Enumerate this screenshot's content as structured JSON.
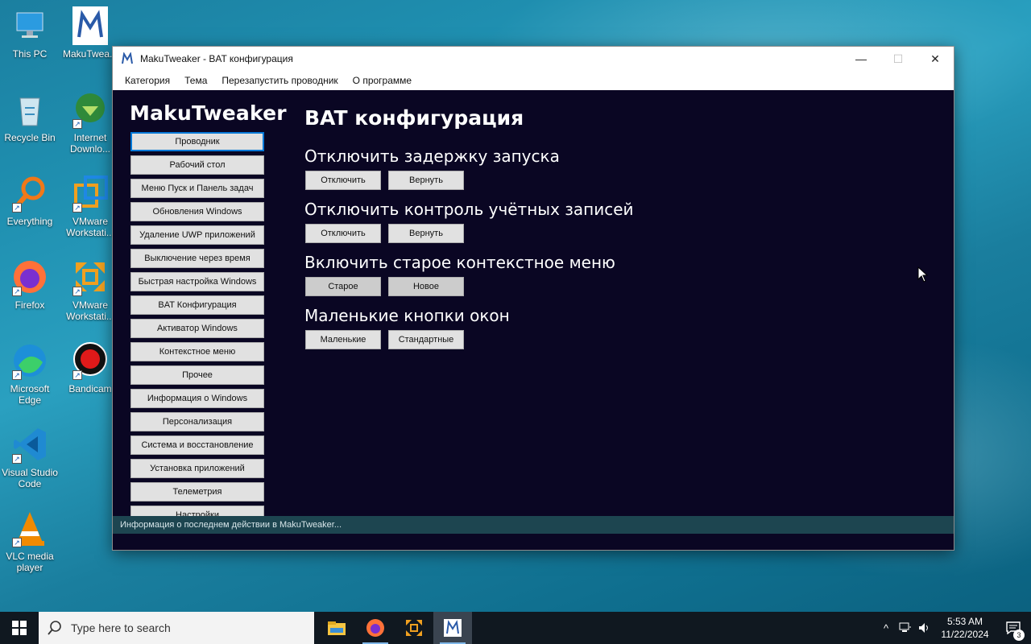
{
  "desktop": {
    "icons": [
      {
        "label": "This PC",
        "icon": "computer-icon"
      },
      {
        "label": "MakuTwea...",
        "icon": "makutweaker-icon"
      },
      {
        "label": "Recycle Bin",
        "icon": "recycle-bin-icon"
      },
      {
        "label": "Internet Downlo...",
        "icon": "internet-download-manager-icon"
      },
      {
        "label": "Everything",
        "icon": "everything-search-icon"
      },
      {
        "label": "VMware Workstati...",
        "icon": "vmware-workstation-icon"
      },
      {
        "label": "Firefox",
        "icon": "firefox-icon"
      },
      {
        "label": "VMware Workstati...",
        "icon": "vmware-player-icon"
      },
      {
        "label": "Microsoft Edge",
        "icon": "edge-icon"
      },
      {
        "label": "Bandicam",
        "icon": "bandicam-icon"
      },
      {
        "label": "Visual Studio Code",
        "icon": "vscode-icon"
      },
      {
        "label": "VLC media player",
        "icon": "vlc-icon"
      }
    ]
  },
  "window": {
    "title": "MakuTweaker - BAT конфигурация",
    "controls": {
      "minimize": "—",
      "maximize": "☐",
      "close": "✕"
    }
  },
  "menu": {
    "items": [
      "Категория",
      "Тема",
      "Перезапустить проводник",
      "О программе"
    ]
  },
  "sidebar": {
    "brand": "MakuTweaker",
    "items": [
      "Проводник",
      "Рабочий стол",
      "Меню Пуск и Панель задач",
      "Обновления Windows",
      "Удаление UWP приложений",
      "Выключение через время",
      "Быстрая настройка Windows",
      "BAT Конфигурация",
      "Активатор Windows",
      "Контекстное меню",
      "Прочее",
      "Информация о Windows",
      "Персонализация",
      "Система и восстановление",
      "Установка приложений",
      "Телеметрия",
      "Настройки"
    ],
    "active_index": 0
  },
  "main": {
    "title": "BAT конфигурация",
    "groups": [
      {
        "heading": "Отключить задержку запуска",
        "buttons": [
          "Отключить",
          "Вернуть"
        ]
      },
      {
        "heading": "Отключить контроль учётных записей",
        "buttons": [
          "Отключить",
          "Вернуть"
        ]
      },
      {
        "heading": "Включить старое контекстное меню",
        "buttons": [
          "Старое",
          "Новое"
        ]
      },
      {
        "heading": "Маленькие кнопки окон",
        "buttons": [
          "Маленькие",
          "Стандартные"
        ]
      }
    ]
  },
  "status": {
    "text": "Информация о последнем действии в MakuTweaker..."
  },
  "taskbar": {
    "search_placeholder": "Type here to search",
    "apps": [
      "file-explorer-icon",
      "firefox-icon",
      "vmware-icon",
      "makutweaker-icon"
    ],
    "clock_time": "5:53 AM",
    "clock_date": "11/22/2024",
    "notification_count": "3"
  },
  "colors": {
    "window_bg": "#0a0623",
    "accent": "#0078d7",
    "status_bg": "#1d4550",
    "taskbar_bg": "#101820"
  }
}
